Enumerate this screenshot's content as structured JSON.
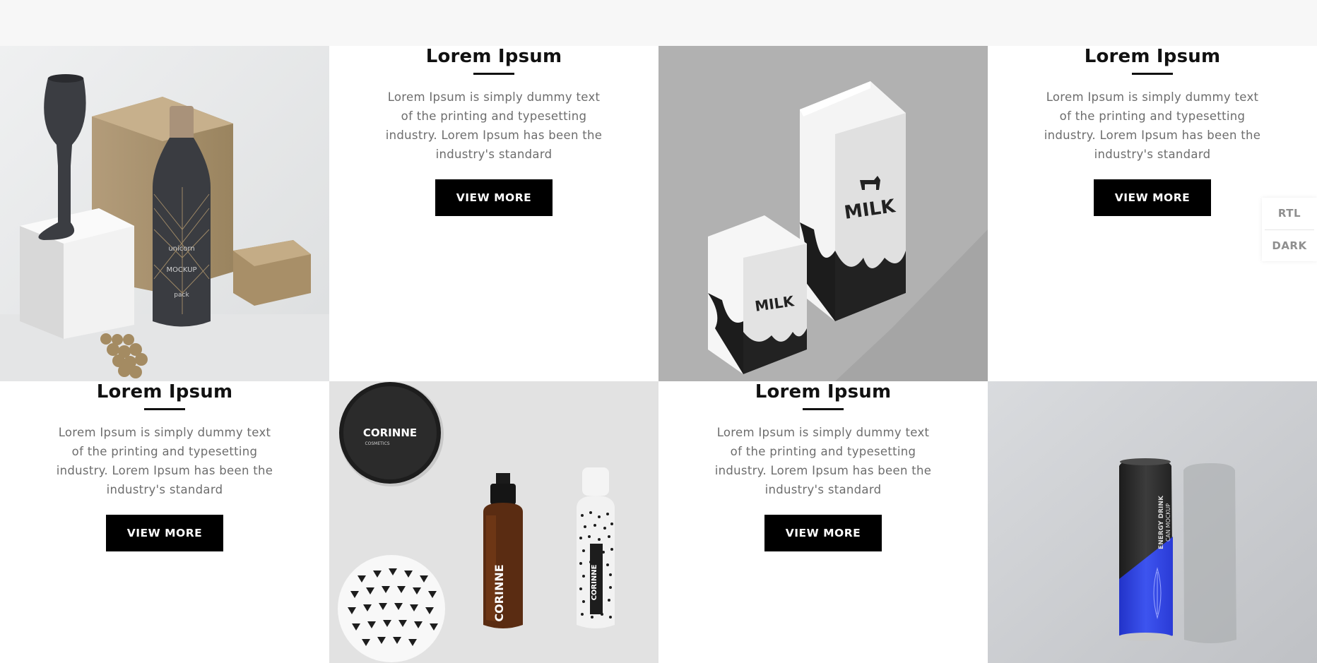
{
  "cards": [
    {
      "id": "wine",
      "type": "image",
      "alt": "Wine bottle and glass mockup",
      "bottle_text": [
        "unicorn",
        "MOCKUP",
        "pack"
      ]
    },
    {
      "id": "text-1",
      "type": "text",
      "title": "Lorem Ipsum",
      "description": "Lorem Ipsum is simply dummy text of the printing and typesetting industry. Lorem Ipsum has been the industry's standard",
      "button": "VIEW MORE"
    },
    {
      "id": "milk",
      "type": "image",
      "alt": "Milk carton mockup",
      "carton_text": "MILK"
    },
    {
      "id": "text-2",
      "type": "text",
      "title": "Lorem Ipsum",
      "description": "Lorem Ipsum is simply dummy text of the printing and typesetting industry. Lorem Ipsum has been the industry's standard",
      "button": "VIEW MORE"
    },
    {
      "id": "text-3",
      "type": "text",
      "title": "Lorem Ipsum",
      "description": "Lorem Ipsum is simply dummy text of the printing and typesetting industry. Lorem Ipsum has been the industry's standard",
      "button": "VIEW MORE"
    },
    {
      "id": "cosmetics",
      "type": "image",
      "alt": "Cosmetics mockup",
      "brand": "CORINNE",
      "brand_sub": "COSMETICS"
    },
    {
      "id": "text-4",
      "type": "text",
      "title": "Lorem Ipsum",
      "description": "Lorem Ipsum is simply dummy text of the printing and typesetting industry. Lorem Ipsum has been the industry's standard",
      "button": "VIEW MORE"
    },
    {
      "id": "can",
      "type": "image",
      "alt": "Energy drink can mockup",
      "can_text": [
        "ENERGY DRINK",
        "CAN MOCKUP"
      ]
    }
  ],
  "side_panel": {
    "rtl": "RTL",
    "dark": "DARK"
  },
  "colors": {
    "accent": "#000000",
    "text": "#6d6d6d",
    "title": "#111111",
    "can_blue": "#2f46e6"
  }
}
